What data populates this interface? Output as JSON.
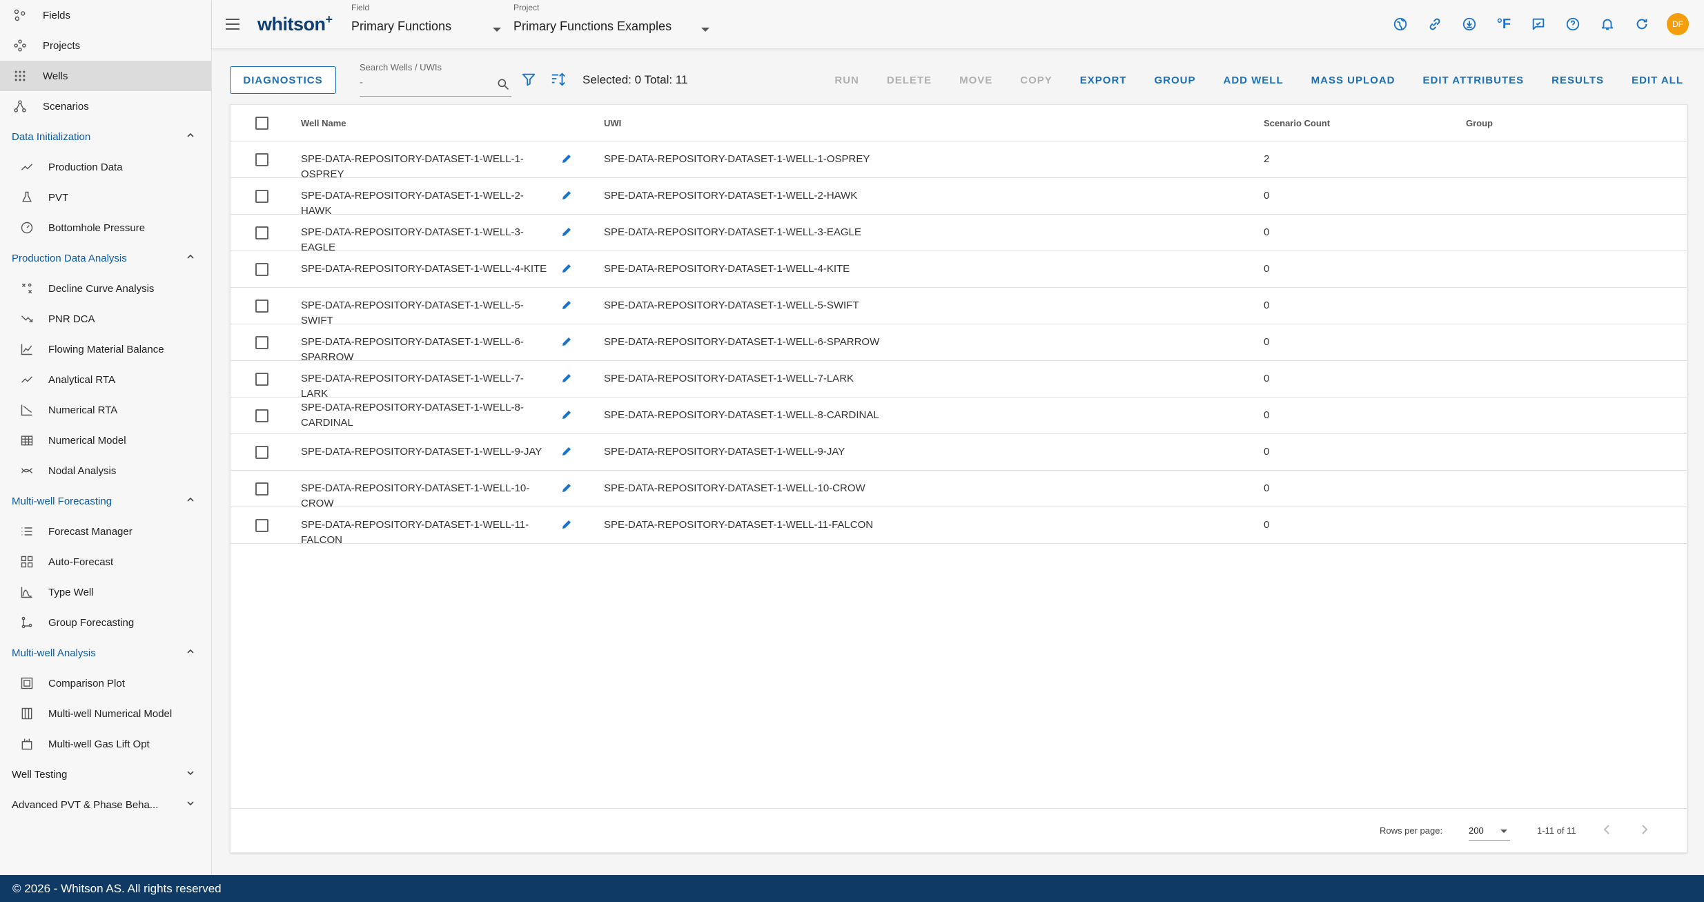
{
  "sidebar": {
    "top_items": [
      {
        "label": "Fields",
        "icon": "fields-icon"
      },
      {
        "label": "Projects",
        "icon": "projects-icon"
      },
      {
        "label": "Wells",
        "icon": "wells-icon",
        "active": true
      },
      {
        "label": "Scenarios",
        "icon": "scenarios-icon"
      }
    ],
    "sections": [
      {
        "title": "Data Initialization",
        "expanded": true,
        "items": [
          {
            "label": "Production Data",
            "icon": "line-chart-icon"
          },
          {
            "label": "PVT",
            "icon": "flask-icon"
          },
          {
            "label": "Bottomhole Pressure",
            "icon": "gauge-icon"
          }
        ]
      },
      {
        "title": "Production Data Analysis",
        "expanded": true,
        "items": [
          {
            "label": "Decline Curve Analysis",
            "icon": "dca-icon"
          },
          {
            "label": "PNR DCA",
            "icon": "trend-down-icon"
          },
          {
            "label": "Flowing Material Balance",
            "icon": "fmb-icon"
          },
          {
            "label": "Analytical RTA",
            "icon": "analytical-rta-icon"
          },
          {
            "label": "Numerical RTA",
            "icon": "numerical-rta-icon"
          },
          {
            "label": "Numerical Model",
            "icon": "grid-model-icon"
          },
          {
            "label": "Nodal Analysis",
            "icon": "nodal-icon"
          }
        ]
      },
      {
        "title": "Multi-well Forecasting",
        "expanded": true,
        "items": [
          {
            "label": "Forecast Manager",
            "icon": "list-icon"
          },
          {
            "label": "Auto-Forecast",
            "icon": "tiles-icon"
          },
          {
            "label": "Type Well",
            "icon": "type-well-icon"
          },
          {
            "label": "Group Forecasting",
            "icon": "group-forecast-icon"
          }
        ]
      },
      {
        "title": "Multi-well Analysis",
        "expanded": true,
        "items": [
          {
            "label": "Comparison Plot",
            "icon": "comparison-icon"
          },
          {
            "label": "Multi-well Numerical Model",
            "icon": "columns-icon"
          },
          {
            "label": "Multi-well Gas Lift Opt",
            "icon": "gas-lift-icon"
          }
        ]
      },
      {
        "title": "Well Testing",
        "expanded": false,
        "items": []
      },
      {
        "title": "Advanced PVT & Phase Beha...",
        "expanded": false,
        "items": []
      }
    ]
  },
  "topbar": {
    "logo": "whitson",
    "logo_sup": "+",
    "field_caption": "Field",
    "field_value": "Primary Functions",
    "project_caption": "Project",
    "project_value": "Primary Functions Examples",
    "icons": [
      "globe-icon",
      "link-icon",
      "download-icon",
      "fahrenheit-icon",
      "feedback-icon",
      "help-icon",
      "bell-icon",
      "refresh-icon"
    ],
    "fahrenheit": "°F",
    "avatar_initials": "DF"
  },
  "toolbar": {
    "diagnostics": "DIAGNOSTICS",
    "search_caption": "Search Wells / UWIs",
    "search_placeholder": "-",
    "selected_total": "Selected: 0 Total: 11",
    "actions": [
      {
        "label": "RUN",
        "enabled": false
      },
      {
        "label": "DELETE",
        "enabled": false
      },
      {
        "label": "MOVE",
        "enabled": false
      },
      {
        "label": "COPY",
        "enabled": false
      },
      {
        "label": "EXPORT",
        "enabled": true
      },
      {
        "label": "GROUP",
        "enabled": true
      },
      {
        "label": "ADD WELL",
        "enabled": true
      },
      {
        "label": "MASS UPLOAD",
        "enabled": true
      },
      {
        "label": "EDIT ATTRIBUTES",
        "enabled": true
      },
      {
        "label": "RESULTS",
        "enabled": true
      },
      {
        "label": "EDIT ALL",
        "enabled": true
      }
    ]
  },
  "table": {
    "headers": {
      "name": "Well Name",
      "uwi": "UWI",
      "count": "Scenario Count",
      "group": "Group"
    },
    "rows": [
      {
        "name": "SPE-DATA-REPOSITORY-DATASET-1-WELL-1-OSPREY",
        "uwi": "SPE-DATA-REPOSITORY-DATASET-1-WELL-1-OSPREY",
        "count": "2"
      },
      {
        "name": "SPE-DATA-REPOSITORY-DATASET-1-WELL-2-HAWK",
        "uwi": "SPE-DATA-REPOSITORY-DATASET-1-WELL-2-HAWK",
        "count": "0"
      },
      {
        "name": "SPE-DATA-REPOSITORY-DATASET-1-WELL-3-EAGLE",
        "uwi": "SPE-DATA-REPOSITORY-DATASET-1-WELL-3-EAGLE",
        "count": "0"
      },
      {
        "name": "SPE-DATA-REPOSITORY-DATASET-1-WELL-4-KITE",
        "uwi": "SPE-DATA-REPOSITORY-DATASET-1-WELL-4-KITE",
        "count": "0"
      },
      {
        "name": "SPE-DATA-REPOSITORY-DATASET-1-WELL-5-SWIFT",
        "uwi": "SPE-DATA-REPOSITORY-DATASET-1-WELL-5-SWIFT",
        "count": "0"
      },
      {
        "name": "SPE-DATA-REPOSITORY-DATASET-1-WELL-6-SPARROW",
        "uwi": "SPE-DATA-REPOSITORY-DATASET-1-WELL-6-SPARROW",
        "count": "0"
      },
      {
        "name": "SPE-DATA-REPOSITORY-DATASET-1-WELL-7-LARK",
        "uwi": "SPE-DATA-REPOSITORY-DATASET-1-WELL-7-LARK",
        "count": "0"
      },
      {
        "name": "SPE-DATA-REPOSITORY-DATASET-1-WELL-8-CARDINAL",
        "uwi": "SPE-DATA-REPOSITORY-DATASET-1-WELL-8-CARDINAL",
        "count": "0"
      },
      {
        "name": "SPE-DATA-REPOSITORY-DATASET-1-WELL-9-JAY",
        "uwi": "SPE-DATA-REPOSITORY-DATASET-1-WELL-9-JAY",
        "count": "0"
      },
      {
        "name": "SPE-DATA-REPOSITORY-DATASET-1-WELL-10-CROW",
        "uwi": "SPE-DATA-REPOSITORY-DATASET-1-WELL-10-CROW",
        "count": "0"
      },
      {
        "name": "SPE-DATA-REPOSITORY-DATASET-1-WELL-11-FALCON",
        "uwi": "SPE-DATA-REPOSITORY-DATASET-1-WELL-11-FALCON",
        "count": "0"
      }
    ],
    "footer": {
      "rows_per_page_label": "Rows per page:",
      "rows_per_page": "200",
      "range": "1-11 of 11"
    }
  },
  "footer": {
    "copyright": "© 2026 - Whitson AS. All rights reserved"
  },
  "colors": {
    "accent": "#1a6fb8",
    "brand": "#0f3f74",
    "footer_bg": "#0f3a66",
    "avatar": "#f59e0b"
  }
}
